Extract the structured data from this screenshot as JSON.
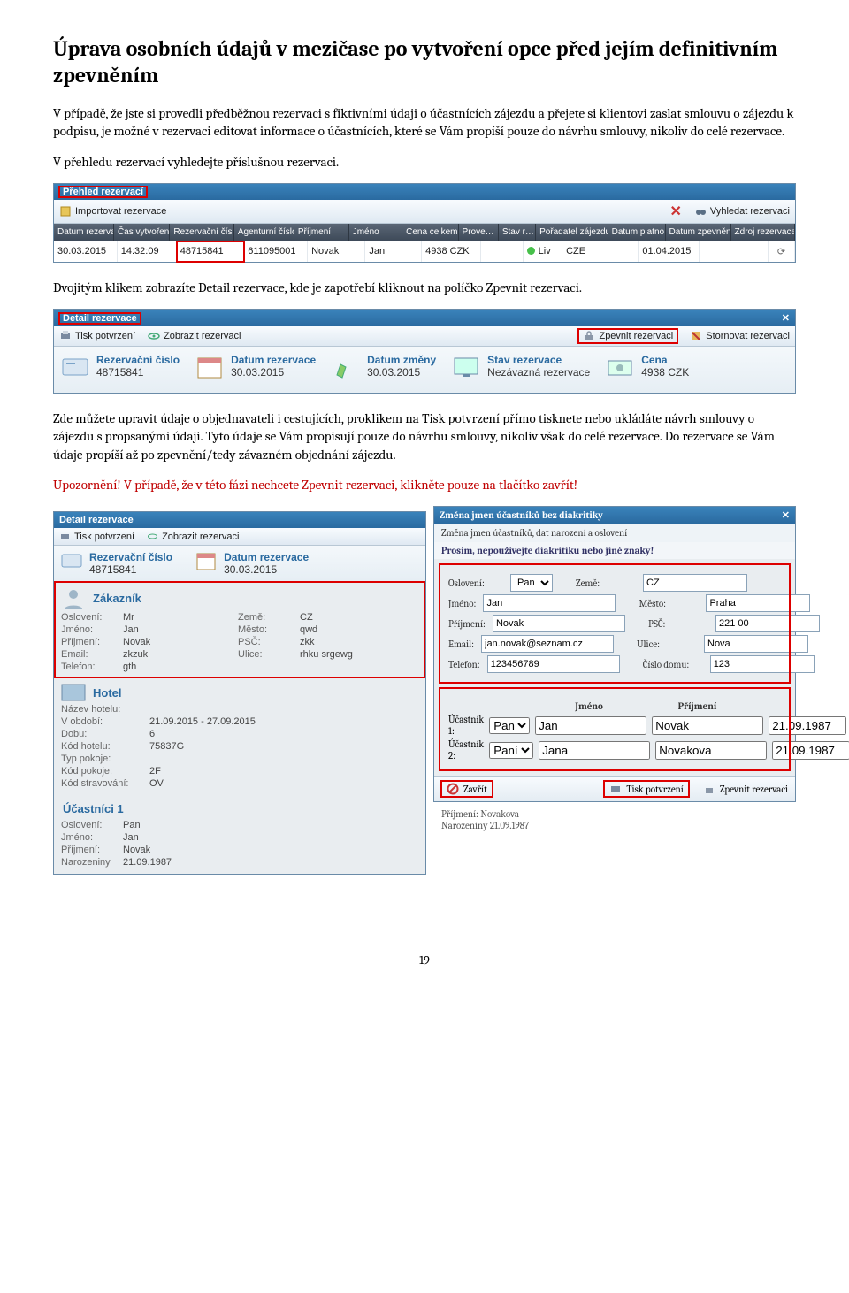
{
  "heading": "Úprava osobních údajů v mezičase po vytvoření opce před jejím definitivním zpevněním",
  "para1": "V případě, že jste si provedli předběžnou rezervaci s fiktivními údaji o účastnících zájezdu a přejete si klientovi zaslat smlouvu o zájezdu k podpisu, je možné v rezervaci editovat informace o účastnících, které se Vám propíší pouze do návrhu smlouvy, nikoliv do celé rezervace.",
  "para2": "V přehledu rezervací vyhledejte příslušnou rezervaci.",
  "para3": "Dvojitým klikem zobrazíte Detail rezervace, kde je zapotřebí kliknout na políčko Zpevnit rezervaci.",
  "para4": "Zde můžete upravit údaje o objednavateli i cestujících, proklikem na Tisk potvrzení přímo tisknete nebo ukládáte návrh smlouvy o zájezdu s propsanými údaji. Tyto údaje se Vám propisují pouze do návrhu smlouvy, nikoliv však do celé rezervace. Do rezervace se Vám údaje propíší až po zpevnění/tedy závazném objednání zájezdu.",
  "para5": "Upozornění! V případě, že v této fázi nechcete Zpevnit rezervaci, klikněte pouze na tlačítko zavřít!",
  "pagenum": "19",
  "s1": {
    "title": "Přehled rezervací",
    "import": "Importovat rezervace",
    "search": "Vyhledat rezervaci",
    "headers": {
      "date": "Datum rezervace",
      "time": "Čas vytvoření",
      "res": "Rezervační číslo",
      "ag": "Agenturní číslo",
      "pr": "Příjmení",
      "jm": "Jméno",
      "cena": "Cena celkem",
      "prov": "Prove…",
      "stav": "Stav r…",
      "por": "Pořadatel zájezdu",
      "dp": "Datum platno…",
      "dz": "Datum zpevněn…",
      "zd": "Zdroj rezervace"
    },
    "row": {
      "date": "30.03.2015",
      "time": "14:32:09",
      "res": "48715841",
      "ag": "611095001",
      "pr": "Novak",
      "jm": "Jan",
      "cena": "4938 CZK",
      "stav": "Liv",
      "por": "CZE",
      "dp": "01.04.2015"
    }
  },
  "s2": {
    "title": "Detail rezervace",
    "tb": {
      "tisk": "Tisk potvrzení",
      "zobraz": "Zobrazit rezervaci",
      "zpevnit": "Zpevnit rezervaci",
      "storno": "Stornovat rezervaci"
    },
    "boxes": {
      "res_l": "Rezervační číslo",
      "res_v": "48715841",
      "dres_l": "Datum rezervace",
      "dres_v": "30.03.2015",
      "dzm_l": "Datum změny",
      "dzm_v": "30.03.2015",
      "stav_l": "Stav rezervace",
      "stav_v": "Nezávazná rezervace",
      "cena_l": "Cena",
      "cena_v": "4938 CZK"
    }
  },
  "s3": {
    "detail": {
      "title": "Detail rezervace",
      "tb": {
        "tisk": "Tisk potvrzení",
        "zobraz": "Zobrazit rezervaci"
      },
      "res_l": "Rezervační číslo",
      "res_v": "48715841",
      "dres_l": "Datum rezervace",
      "dres_v": "30.03.2015",
      "zak_hd": "Zákazník",
      "zak": {
        "osloveni_k": "Oslovení:",
        "osloveni_v": "Mr",
        "zeme_k": "Země:",
        "zeme_v": "CZ",
        "jmeno_k": "Jméno:",
        "jmeno_v": "Jan",
        "mesto_k": "Město:",
        "mesto_v": "qwd",
        "prijmeni_k": "Příjmení:",
        "prijmeni_v": "Novak",
        "psc_k": "PSČ:",
        "psc_v": "zkk",
        "email_k": "Email:",
        "email_v": "zkzuk",
        "ulice_k": "Ulice:",
        "ulice_v": "rhku srgewg",
        "tel_k": "Telefon:",
        "tel_v": "gth"
      },
      "hotel_hd": "Hotel",
      "hotel": {
        "nazev_k": "Název hotelu:",
        "obd_k": "V období:",
        "obd_v": "21.09.2015 - 27.09.2015",
        "dobu_k": "Dobu:",
        "dobu_v": "6",
        "kodh_k": "Kód hotelu:",
        "kodh_v": "75837G",
        "typ_k": "Typ pokoje:",
        "kodp_k": "Kód pokoje:",
        "kodp_v": "2F",
        "strav_k": "Kód stravování:",
        "strav_v": "OV"
      },
      "uc_hd": "Účastníci 1",
      "uc": {
        "osl_k": "Oslovení:",
        "osl_v": "Pan",
        "jm_k": "Jméno:",
        "jm_v": "Jan",
        "pr_k": "Příjmení:",
        "pr_v": "Novak",
        "nar_k": "Narozeniny",
        "nar_v": "21.09.1987"
      },
      "uc_right": {
        "pr_k": "Příjmení:",
        "pr_v": "Novakova",
        "nar_k": "Narozeniny",
        "nar_v": "21.09.1987"
      }
    },
    "modal": {
      "title": "Změna jmen účastníků bez diakritiky",
      "sub": "Změna jmen účastníků, dat narození a oslovení",
      "warn": "Prosím, nepoužívejte diakritiku nebo jiné znaky!",
      "labels": {
        "osl": "Oslovení:",
        "jm": "Jméno:",
        "pr": "Příjmení:",
        "em": "Email:",
        "tel": "Telefon:",
        "zeme": "Země:",
        "mesto": "Město:",
        "psc": "PSČ:",
        "ulice": "Ulice:",
        "cislo": "Číslo domu:"
      },
      "vals": {
        "osl": "Pan",
        "jm": "Jan",
        "pr": "Novak",
        "em": "jan.novak@seznam.cz",
        "tel": "123456789",
        "zeme": "CZ",
        "mesto": "Praha",
        "psc": "221 00",
        "ulice": "Nova",
        "cislo": "123"
      },
      "part_hd": {
        "jm": "Jméno",
        "pr": "Příjmení"
      },
      "p1": {
        "lbl": "Účastník 1:",
        "osl": "Pan",
        "jm": "Jan",
        "pr": "Novak",
        "dt": "21.09.1987"
      },
      "p2": {
        "lbl": "Účastník 2:",
        "osl": "Paní",
        "jm": "Jana",
        "pr": "Novakova",
        "dt": "21.09.1987"
      },
      "foot": {
        "zavrit": "Zavřít",
        "tisk": "Tisk potvrzení",
        "zpevnit": "Zpevnit rezervaci"
      }
    }
  }
}
